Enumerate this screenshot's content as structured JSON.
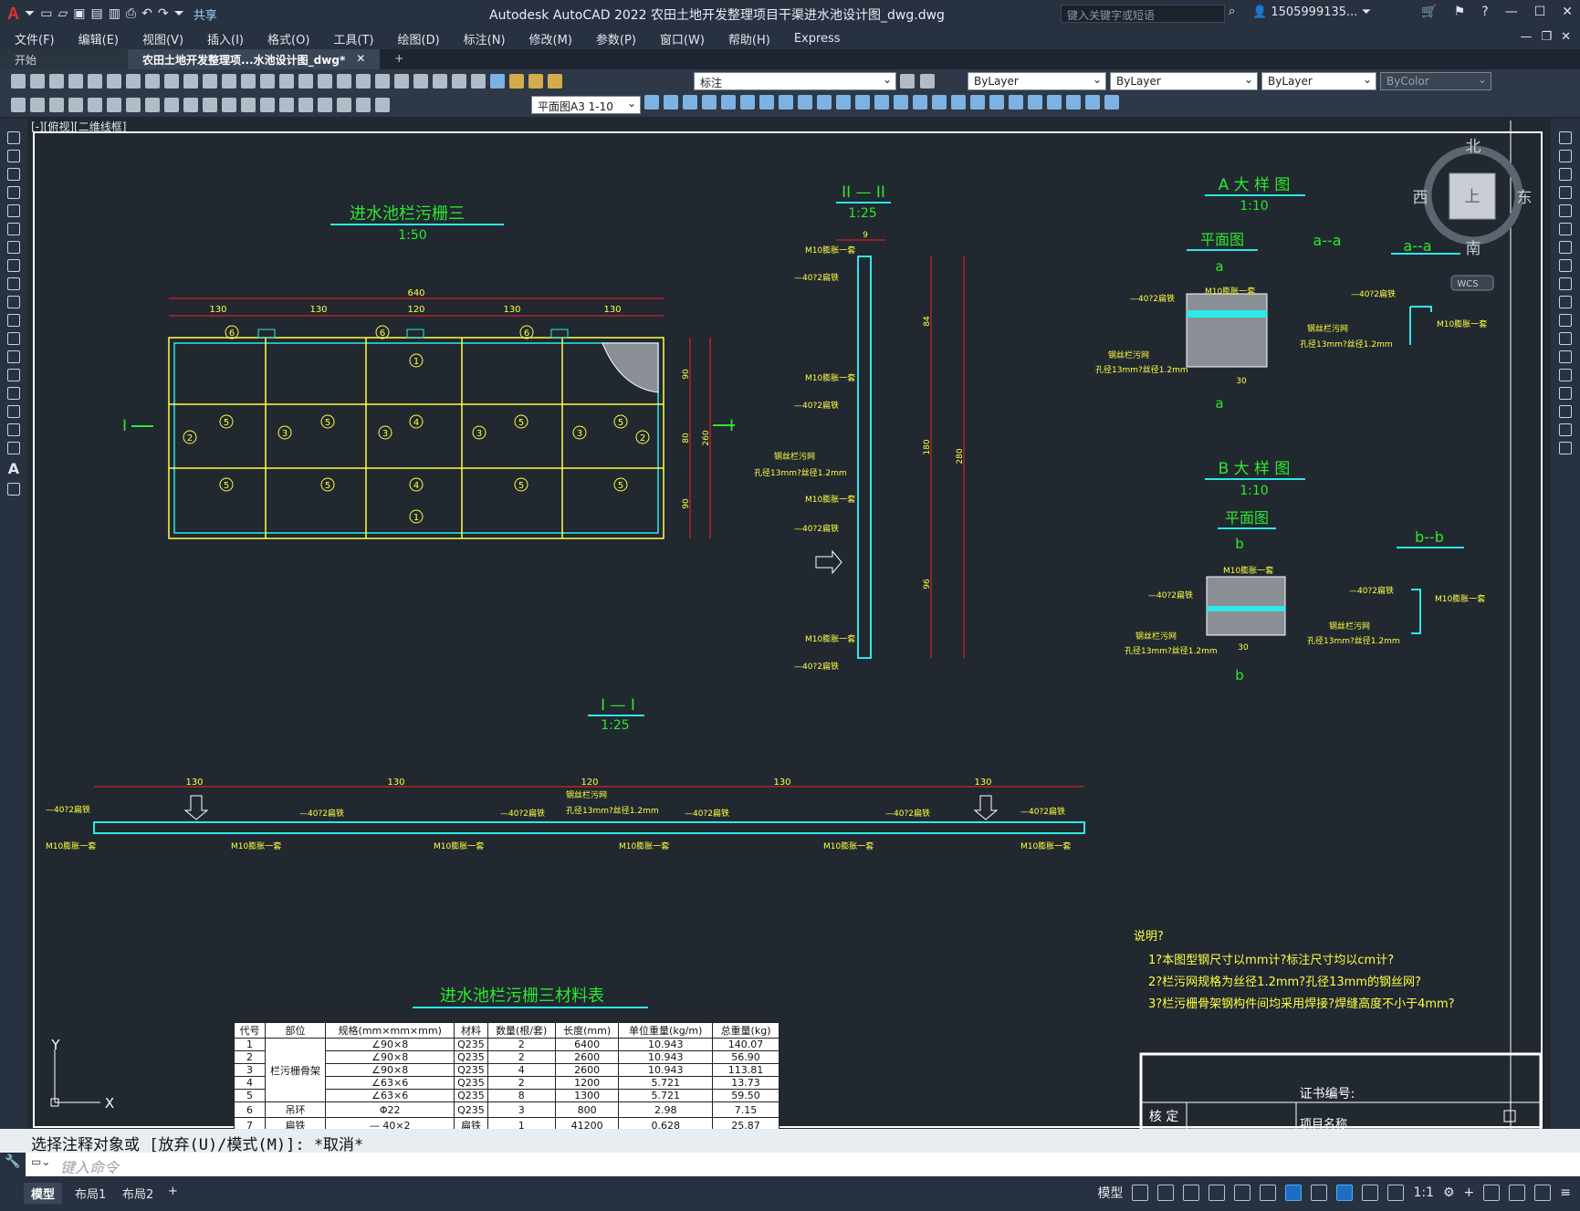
{
  "app": {
    "title": "Autodesk AutoCAD 2022    农田土地开发整理项目干渠进水池设计图_dwg.dwg",
    "share_label": "共享",
    "search_placeholder": "键入关键字或短语",
    "user": "1505999135...",
    "logo": "A"
  },
  "menu": [
    "文件(F)",
    "编辑(E)",
    "视图(V)",
    "插入(I)",
    "格式(O)",
    "工具(T)",
    "绘图(D)",
    "标注(N)",
    "修改(M)",
    "参数(P)",
    "窗口(W)",
    "帮助(H)",
    "Express"
  ],
  "tabs": {
    "start": "开始",
    "active": "农田土地开发整理项...水池设计图_dwg*",
    "close": "✕",
    "add": "+"
  },
  "toolbars": {
    "layer_value": "标注",
    "color_value": "ByLayer",
    "linetype_value": "ByLayer",
    "lineweight_value": "ByLayer",
    "plotstyle_value": "ByColor",
    "dimstyle_value": "平面图A3 1-10"
  },
  "viewport_label": "[-][俯视][二维线框]",
  "viewcube": {
    "north": "北",
    "south": "南",
    "east": "东",
    "west": "西",
    "face": "上",
    "wcs": "WCS"
  },
  "ucs": {
    "x": "X",
    "y": "Y"
  },
  "drawing": {
    "main_title": "进水池栏污栅三",
    "main_scale": "1:50",
    "sec2_title": "II — II",
    "sec2_scale": "1:25",
    "sec1_title": "I — I",
    "sec1_scale": "1:25",
    "detailA_title": "A 大 样 图",
    "detailA_scale": "1:10",
    "detailB_title": "B 大 样 图",
    "detailB_scale": "1:10",
    "plan_label": "平面图",
    "aa_label": "a--a",
    "bb_label": "b--b",
    "letter_a": "a",
    "letter_b": "b",
    "section_marker": "I",
    "dim_total": "640",
    "dims_top": [
      "130",
      "130",
      "120",
      "130",
      "130"
    ],
    "dims_side": [
      "90",
      "80",
      "90"
    ],
    "dim_side_total": "260",
    "dims_sec2": [
      "9",
      "84",
      "180",
      "96",
      "280"
    ],
    "dim_detail": "30",
    "grid_numbers": [
      "6",
      "6",
      "6",
      "1",
      "2",
      "5",
      "3",
      "5",
      "3",
      "4",
      "3",
      "5",
      "3",
      "5",
      "2",
      "5",
      "5",
      "4",
      "5",
      "5",
      "1"
    ],
    "label_angle": "—40?2扁铁",
    "label_m10": "M10膨胀一套",
    "label_mesh1": "钢丝栏污网",
    "label_mesh2": "孔径13mm?丝径1.2mm",
    "notes": [
      "说明?",
      "1?本图型钢尺寸以mm计?标注尺寸均以cm计?",
      "2?栏污网规格为丝径1.2mm?孔径13mm的钢丝网?",
      "3?栏污栅骨架钢构件间均采用焊接?焊缝高度不小于4mm?"
    ],
    "table_title": "进水池栏污栅三材料表",
    "table_headers": [
      "代号",
      "部位",
      "规格(mm×mm×mm)",
      "材料",
      "数量(根/套)",
      "长度(mm)",
      "单位重量(kg/m)",
      "总重量(kg)"
    ],
    "table_part": "栏污栅骨架",
    "table_rows": [
      [
        "1",
        "",
        "∠90×8",
        "Q235",
        "2",
        "6400",
        "10.943",
        "140.07"
      ],
      [
        "2",
        "",
        "∠90×8",
        "Q235",
        "2",
        "2600",
        "10.943",
        "56.90"
      ],
      [
        "3",
        "",
        "∠90×8",
        "Q235",
        "4",
        "2600",
        "10.943",
        "113.81"
      ],
      [
        "4",
        "",
        "∠63×6",
        "Q235",
        "2",
        "1200",
        "5.721",
        "13.73"
      ],
      [
        "5",
        "",
        "∠63×6",
        "Q235",
        "8",
        "1300",
        "5.721",
        "59.50"
      ],
      [
        "6",
        "吊环",
        "Φ22",
        "Q235",
        "3",
        "800",
        "2.98",
        "7.15"
      ],
      [
        "7",
        "扁铁",
        "— 40×2",
        "扁铁",
        "1",
        "41200",
        "0.628",
        "25.87"
      ]
    ],
    "tb_cert": "证书编号:",
    "tb_check": "核 定",
    "tb_project": "项目名称"
  },
  "command": {
    "history": "选择注释对象或 [放弃(U)/模式(M)]: *取消*",
    "placeholder": "键入命令"
  },
  "status": {
    "layouts": [
      "模型",
      "布局1",
      "布局2",
      "+"
    ],
    "model_label": "模型",
    "scale": "1:1"
  }
}
